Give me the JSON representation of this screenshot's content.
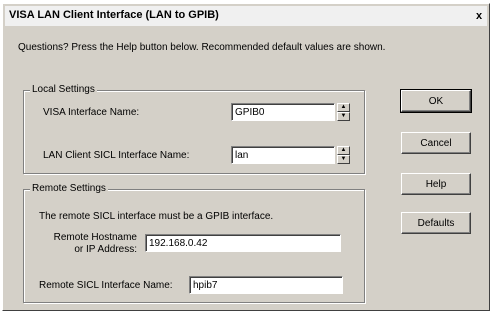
{
  "window": {
    "title": "VISA LAN Client Interface (LAN to GPIB)",
    "close_glyph": "x"
  },
  "intro_text": "Questions?  Press the Help button below.  Recommended default values are shown.",
  "local_settings": {
    "legend": "Local Settings",
    "visa_label": "VISA Interface Name:",
    "visa_value": "GPIB0",
    "sicl_label": "LAN Client SICL Interface Name:",
    "sicl_value": "lan"
  },
  "remote_settings": {
    "legend": "Remote Settings",
    "note": "The remote SICL interface must be a GPIB interface.",
    "host_label_1": "Remote Hostname",
    "host_label_2": "or IP Address:",
    "host_value": "192.168.0.42",
    "remote_sicl_label": "Remote SICL Interface Name:",
    "remote_sicl_value": "hpib7"
  },
  "buttons": {
    "ok": "OK",
    "cancel": "Cancel",
    "help": "Help",
    "defaults": "Defaults"
  },
  "spin_glyphs": {
    "up": "▲",
    "down": "▼"
  }
}
